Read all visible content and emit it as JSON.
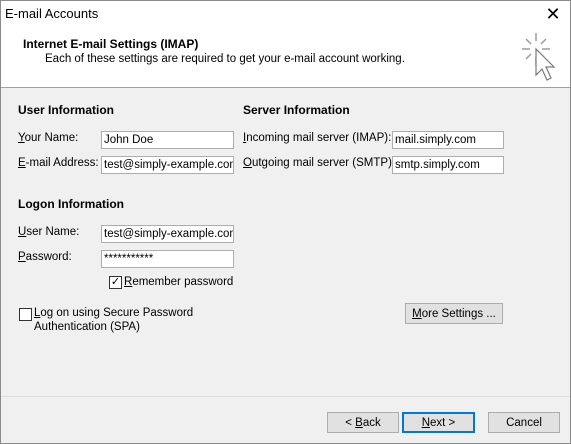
{
  "window": {
    "title": "E-mail Accounts",
    "close_glyph": "✕"
  },
  "header": {
    "title": "Internet E-mail Settings (IMAP)",
    "subtitle": "Each of these settings are required to get your e-mail account working.",
    "icon": "wizard-cursor-icon"
  },
  "user_info": {
    "title": "User Information",
    "name_label_u": "Y",
    "name_label_rest": "our Name:",
    "name_value": "John Doe",
    "email_label_u": "E",
    "email_label_rest": "-mail Address:",
    "email_value": "test@simply-example.com"
  },
  "server_info": {
    "title": "Server Information",
    "incoming_label_u": "I",
    "incoming_label_rest": "ncoming mail server (IMAP):",
    "incoming_value": "mail.simply.com",
    "outgoing_label_u": "O",
    "outgoing_label_rest": "utgoing mail server (SMTP):",
    "outgoing_value": "smtp.simply.com"
  },
  "logon_info": {
    "title": "Logon Information",
    "username_label_u": "U",
    "username_label_rest": "ser Name:",
    "username_value": "test@simply-example.com",
    "password_label_u": "P",
    "password_label_rest": "assword:",
    "password_value": "***********",
    "remember_label_u": "R",
    "remember_label_rest": "emember password",
    "remember_checked": true,
    "spa_label_u": "L",
    "spa_label_rest": "og on using Secure Password",
    "spa_label_line2": "Authentication (SPA)",
    "spa_checked": false
  },
  "buttons": {
    "more_settings_u": "M",
    "more_settings_rest": "ore Settings ...",
    "back_pre": "< ",
    "back_u": "B",
    "back_rest": "ack",
    "next_u": "N",
    "next_rest": "ext >",
    "cancel": "Cancel"
  },
  "colors": {
    "default_button_border": "#0078d7",
    "header_bg": "#ffffff",
    "body_bg": "#f0f0f0"
  }
}
